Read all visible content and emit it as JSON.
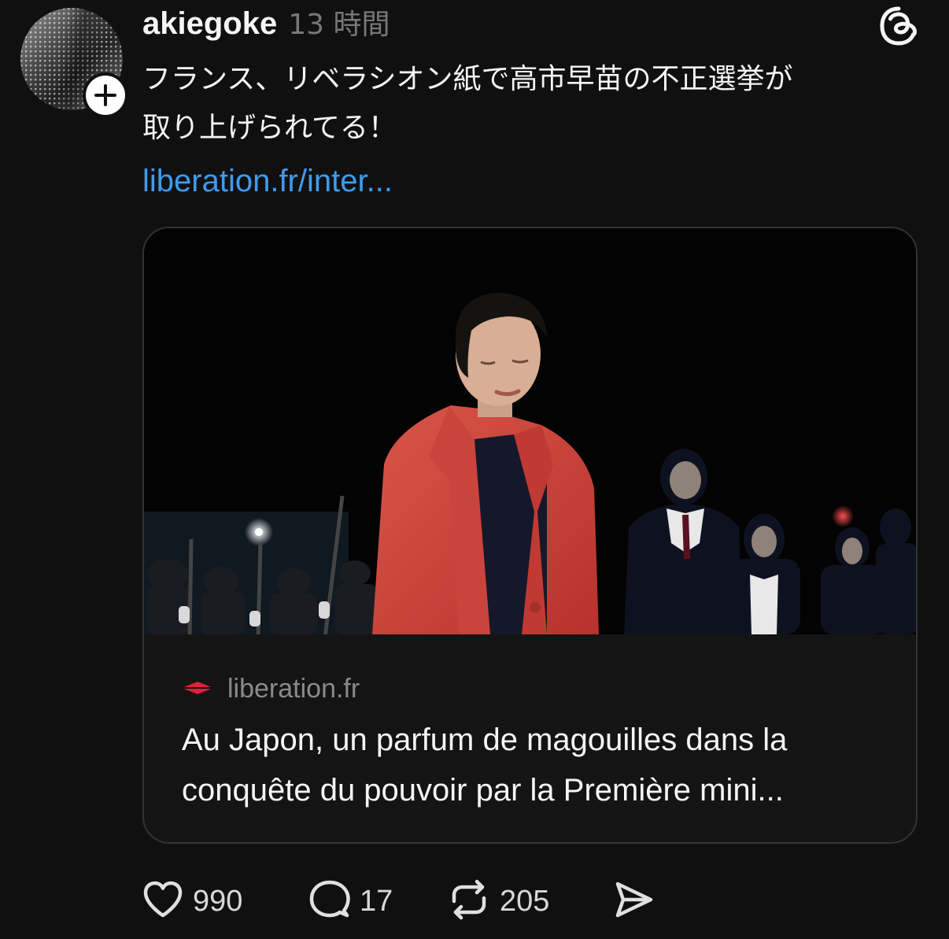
{
  "post": {
    "username": "akiegoke",
    "timestamp": "13 時間",
    "text_line_1": "フランス、リベラシオン紙で高市早苗の不正選挙が",
    "text_line_2": "取り上げられてる！",
    "link": "liberation.fr/inter..."
  },
  "card": {
    "site": "liberation.fr",
    "title_line_1": "Au Japon, un parfum de magouilles dans la",
    "title_line_2": "conquête du pouvoir par la Première mini..."
  },
  "actions": {
    "likes": "990",
    "replies": "17",
    "reposts": "205"
  },
  "colors": {
    "background": "#101010",
    "text": "#f3f5f7",
    "muted": "#777777",
    "link": "#3d9cf0",
    "liberation_brand": "#e2203a"
  },
  "icons": [
    "follow-plus-icon",
    "threads-logo-icon",
    "liberation-logo-icon",
    "heart-icon",
    "reply-icon",
    "repost-icon",
    "share-icon"
  ]
}
